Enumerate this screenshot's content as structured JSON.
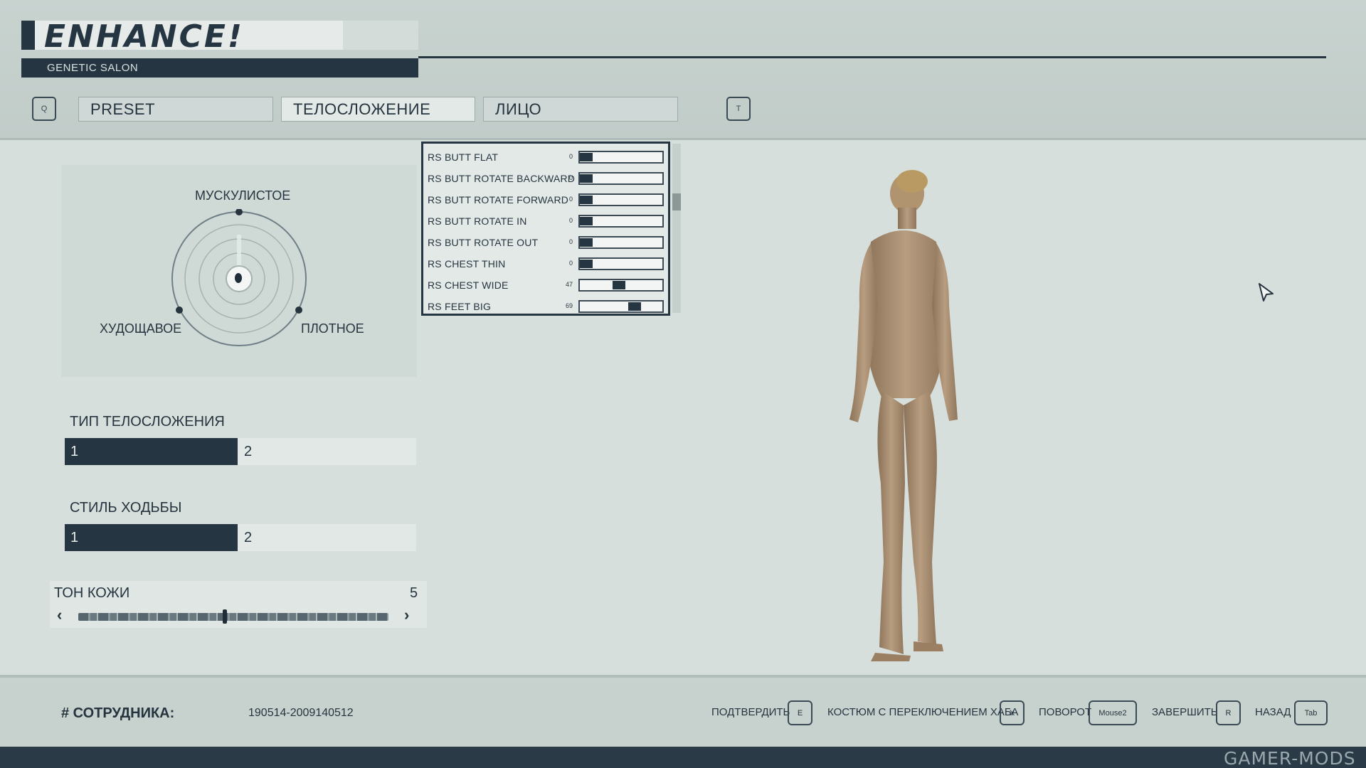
{
  "header": {
    "logo": "ENHANCE!",
    "subtitle": "GENETIC SALON",
    "key_prev": "Q",
    "key_next": "T",
    "tabs": [
      {
        "label": "PRESET"
      },
      {
        "label": "ТЕЛОСЛОЖЕНИЕ"
      },
      {
        "label": "ЛИЦО"
      }
    ],
    "active_tab": "ТЕЛОСЛОЖЕНИЕ"
  },
  "body_wheel": {
    "top_label": "МУСКУЛИСТОЕ",
    "left_label": "ХУДОЩАВОЕ",
    "right_label": "ПЛОТНОЕ"
  },
  "body_type": {
    "label": "ТИП ТЕЛОСЛОЖЕНИЯ",
    "options": [
      "1",
      "2"
    ],
    "selected": "1"
  },
  "walk_style": {
    "label": "СТИЛЬ ХОДЬБЫ",
    "options": [
      "1",
      "2"
    ],
    "selected": "1"
  },
  "skin_tone": {
    "label": "ТОН КОЖИ",
    "value": "5",
    "prev": "‹",
    "next": "›"
  },
  "sliders": [
    {
      "name": "RS BUTT FLAT",
      "value": "0",
      "level": 0
    },
    {
      "name": "RS BUTT ROTATE BACKWARD",
      "value": "0",
      "level": 0
    },
    {
      "name": "RS BUTT ROTATE FORWARD",
      "value": "0",
      "level": 0
    },
    {
      "name": "RS BUTT ROTATE IN",
      "value": "0",
      "level": 0
    },
    {
      "name": "RS BUTT ROTATE OUT",
      "value": "0",
      "level": 0
    },
    {
      "name": "RS CHEST THIN",
      "value": "0",
      "level": 0
    },
    {
      "name": "RS CHEST WIDE",
      "value": "47",
      "level": 0.47
    },
    {
      "name": "RS FEET BIG",
      "value": "69",
      "level": 0.69
    }
  ],
  "footer": {
    "employee_label": "# СОТРУДНИКА:",
    "employee_id": "190514-2009140512",
    "hints": {
      "confirm": "ПОДТВЕРДИТЬ",
      "confirm_key": "E",
      "suit": "КОСТЮМ С ПЕРЕКЛЮЧЕНИЕМ ХАБА",
      "suit_key": "X",
      "rotate": "ПОВОРОТ",
      "rotate_key": "Mouse2",
      "finish": "ЗАВЕРШИТЬ",
      "finish_key": "R",
      "back": "НАЗАД",
      "back_key": "Tab"
    }
  },
  "watermark": "GAMER-MODS",
  "colors": {
    "accent": "#253642",
    "panel": "#cfd9d6",
    "background": "#d7dfdc"
  },
  "icons": {
    "cursor": "cursor-arrow-icon",
    "prev": "chevron-left-icon",
    "next": "chevron-right-icon"
  }
}
